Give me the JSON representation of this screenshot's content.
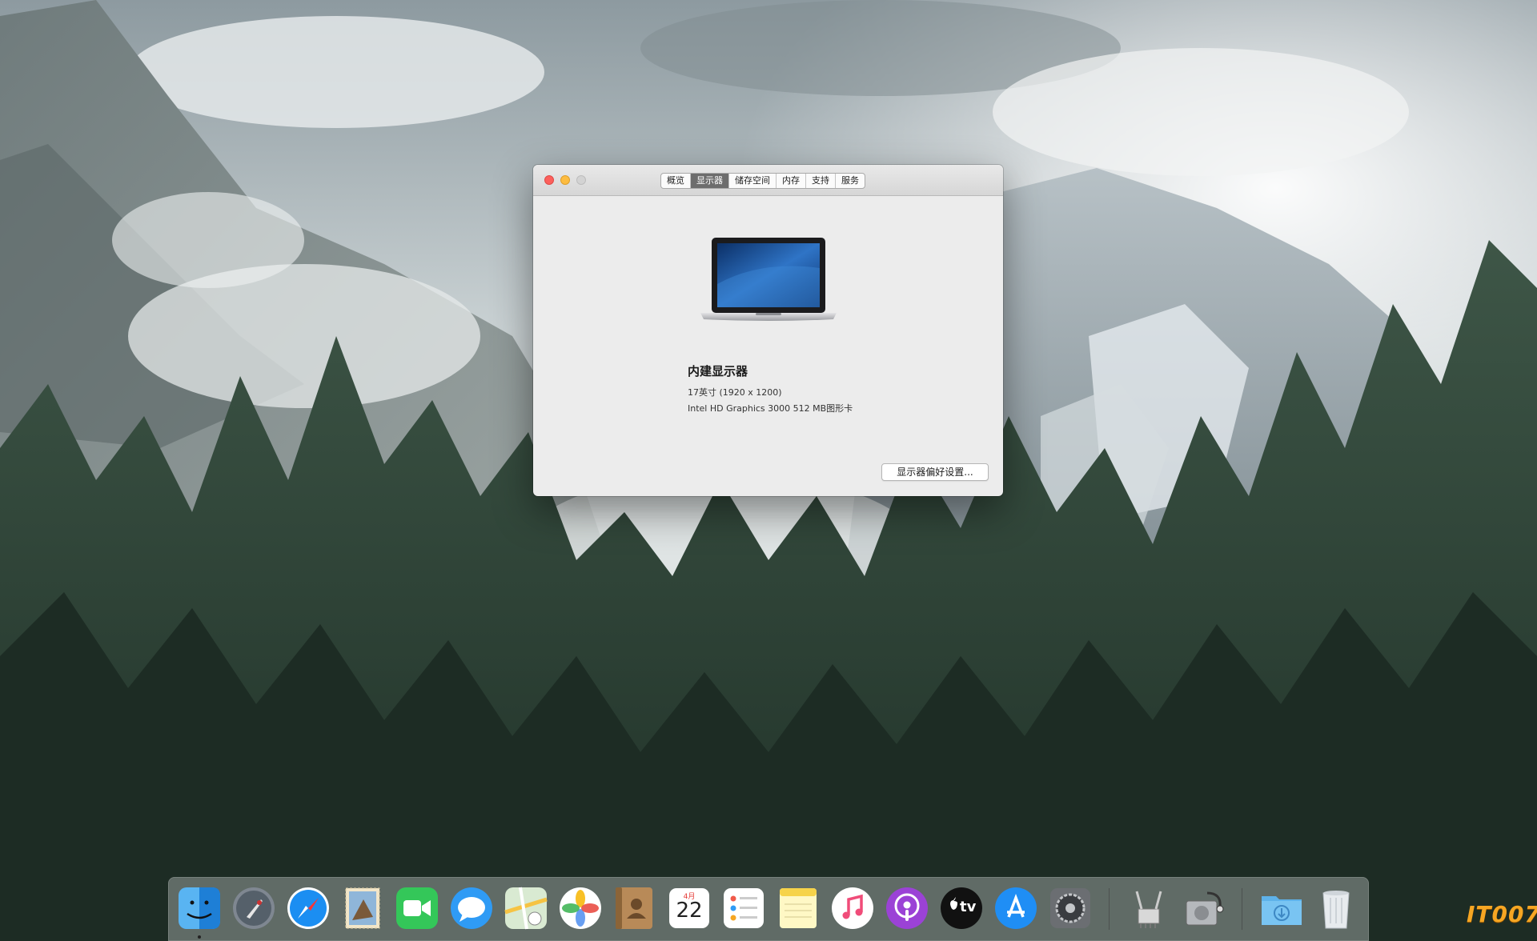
{
  "window": {
    "tabs": [
      {
        "label": "概览",
        "active": false
      },
      {
        "label": "显示器",
        "active": true
      },
      {
        "label": "储存空间",
        "active": false
      },
      {
        "label": "内存",
        "active": false
      },
      {
        "label": "支持",
        "active": false
      },
      {
        "label": "服务",
        "active": false
      }
    ],
    "display_title": "内建显示器",
    "display_size": "17英寸 (1920 x 1200)",
    "graphics": "Intel HD Graphics 3000 512 MB图形卡",
    "pref_button": "显示器偏好设置..."
  },
  "dock": {
    "calendar_month": "4月",
    "calendar_day": "22",
    "tv_label": "tv",
    "apps": [
      "finder",
      "launchpad",
      "safari",
      "mail",
      "facetime",
      "messages",
      "maps",
      "photos",
      "contacts",
      "calendar",
      "reminders",
      "notes",
      "music",
      "podcasts",
      "tv",
      "app-store",
      "system-preferences",
      "system-information",
      "disk-utility",
      "downloads",
      "trash"
    ]
  },
  "watermark": "IT007",
  "colors": {
    "close": "#fc605c",
    "minimize": "#fdbc40",
    "zoom": "#d3d3d3",
    "active_tab": "#6d6d6d"
  }
}
